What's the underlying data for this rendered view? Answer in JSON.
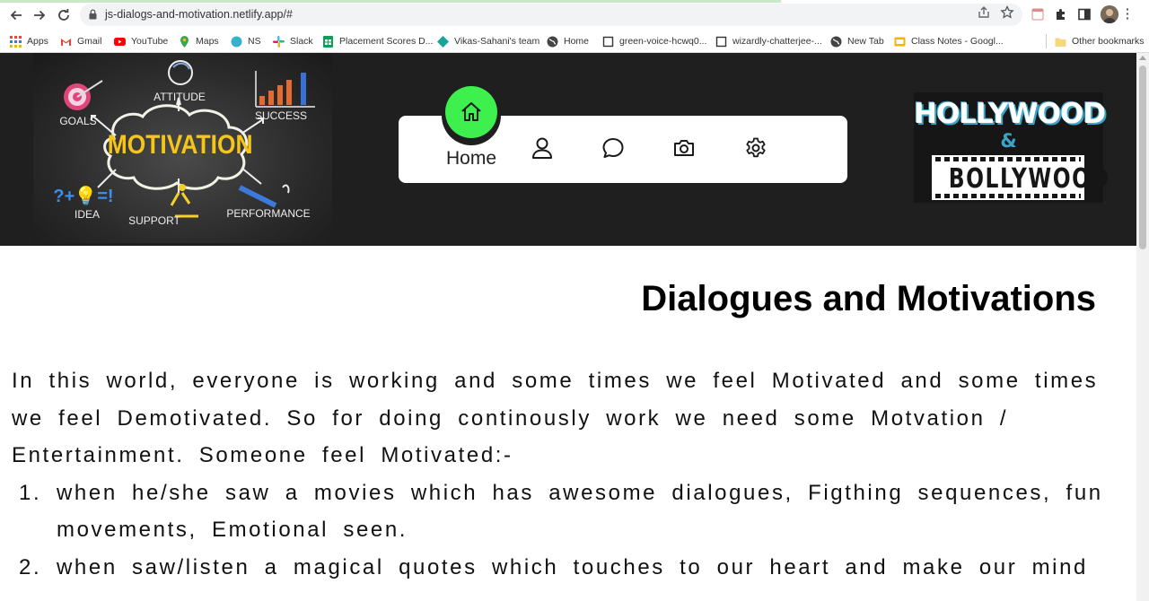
{
  "browser": {
    "url": "js-dialogs-and-motivation.netlify.app/#",
    "bookmarks": [
      {
        "label": "Apps",
        "icon": "apps-grid-icon"
      },
      {
        "label": "Gmail",
        "icon": "gmail-icon"
      },
      {
        "label": "YouTube",
        "icon": "youtube-icon"
      },
      {
        "label": "Maps",
        "icon": "maps-icon"
      },
      {
        "label": "NS",
        "icon": "ns-icon"
      },
      {
        "label": "Slack",
        "icon": "slack-icon"
      },
      {
        "label": "Placement Scores D...",
        "icon": "sheets-icon"
      },
      {
        "label": "Vikas-Sahani's team",
        "icon": "diamond-icon"
      },
      {
        "label": "Home",
        "icon": "globe-icon"
      },
      {
        "label": "green-voice-hcwq0...",
        "icon": "page-icon"
      },
      {
        "label": "wizardly-chatterjee-...",
        "icon": "page-icon"
      },
      {
        "label": "New Tab",
        "icon": "globe-icon"
      },
      {
        "label": "Class Notes - Googl...",
        "icon": "slides-icon"
      }
    ],
    "other_bookmarks": "Other bookmarks"
  },
  "header": {
    "logo_left": {
      "labels": [
        "ATTITUDE",
        "GOALS",
        "SUCCESS",
        "MOTIVATION",
        "IDEA",
        "SUPPORT",
        "PERFORMANCE",
        "?+💡=!"
      ]
    },
    "nav": {
      "home_label": "Home",
      "items": [
        {
          "icon": "home-icon",
          "active": true
        },
        {
          "icon": "user-icon"
        },
        {
          "icon": "chat-icon"
        },
        {
          "icon": "camera-icon"
        },
        {
          "icon": "settings-icon"
        }
      ]
    },
    "logo_right": {
      "line1": "HOLLYWOOD",
      "amp": "&",
      "line2": "BOLLYWOOD"
    }
  },
  "main": {
    "title": "Dialogues and Motivations",
    "intro_lines": [
      "In this world, everyone is working and some times we feel Motivated and some times",
      "we feel Demotivated. So for doing continously work we need some Motvation /",
      "Entertainment. Someone feel Motivated:-"
    ],
    "list": [
      {
        "num": "1.",
        "lines": [
          "when he/she saw a movies which has awesome dialogues, Figthing sequences, fun",
          "movements, Emotional seen."
        ]
      },
      {
        "num": "2.",
        "lines": [
          "when saw/listen a magical quotes which touches to our heart and make our mind"
        ]
      }
    ]
  },
  "colors": {
    "header_bg": "#1f1f1f",
    "home_active": "#3df04e",
    "accent_teal": "#3aa5c9"
  }
}
